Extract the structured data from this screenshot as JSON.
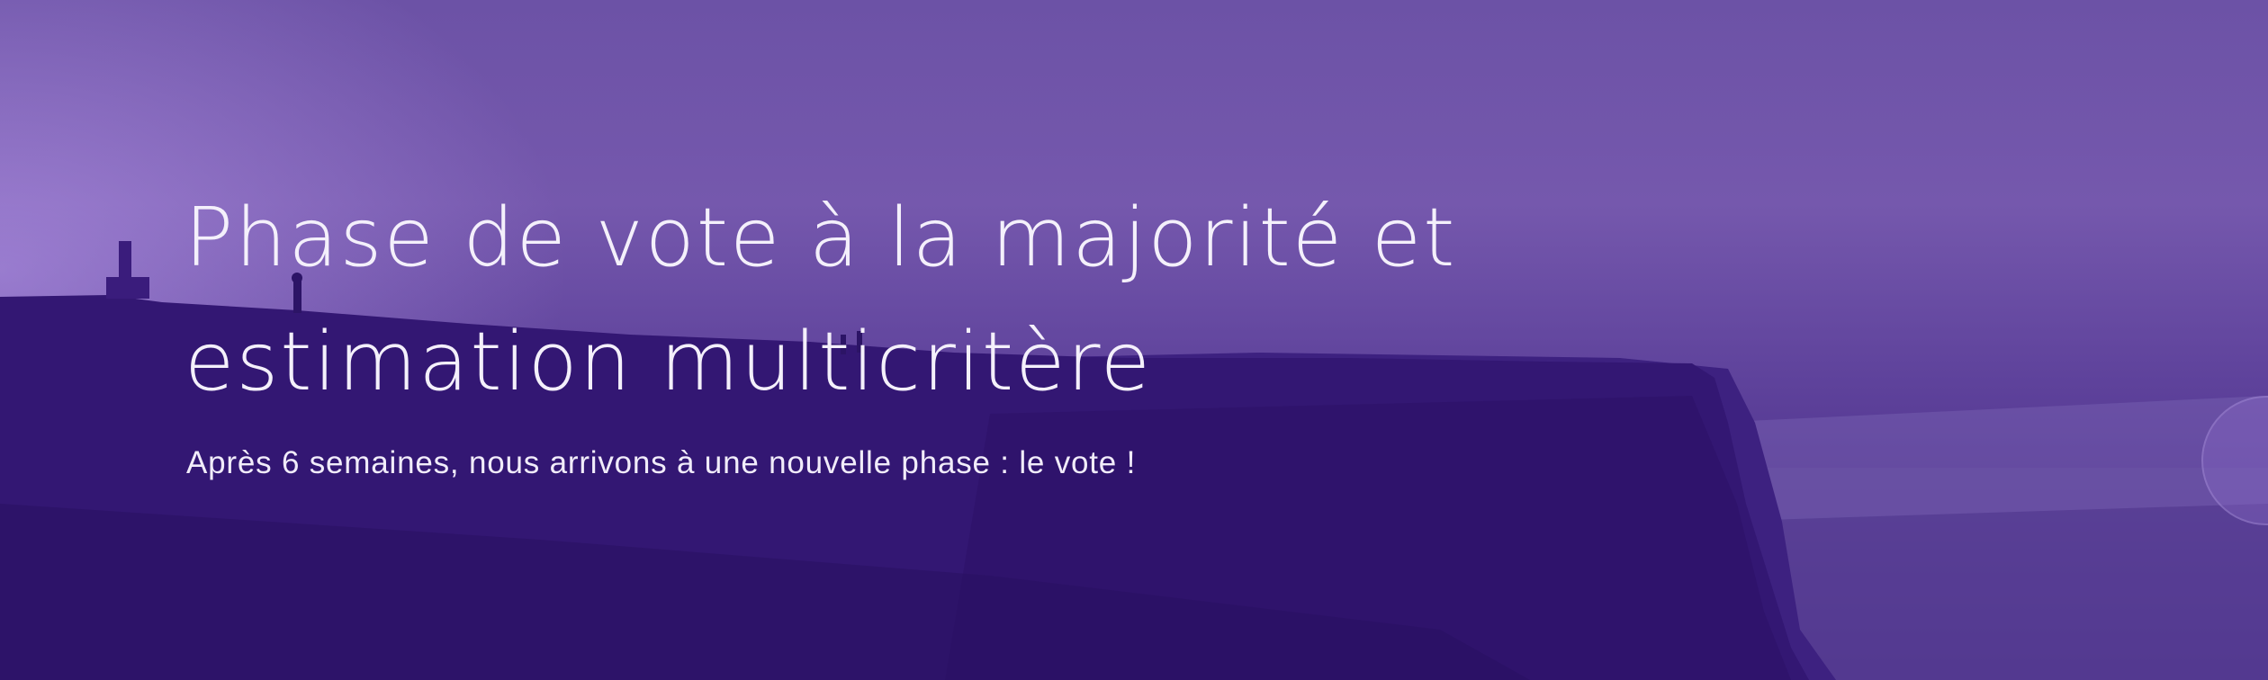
{
  "hero": {
    "title": "Phase de vote à la majorité et estimation multicritère",
    "subtitle": "Après 6 semaines, nous arrivons à une nouvelle phase : le vote !",
    "background_image": "purple-tinted-cliff-coastline",
    "overlay_color": "#4b2a8f"
  }
}
